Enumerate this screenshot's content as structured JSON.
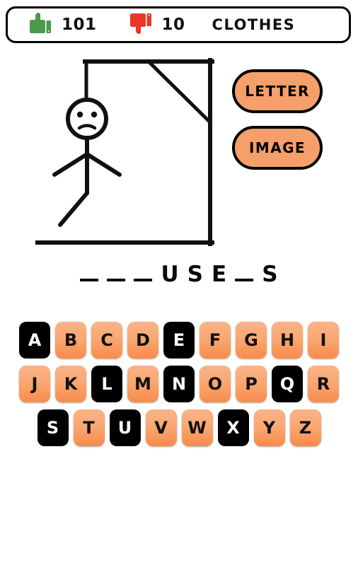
{
  "statusbar": {
    "thumbs_up_icon": "thumbs-up-icon",
    "thumbs_up_count": "101",
    "thumbs_down_icon": "thumbs-down-icon",
    "thumbs_down_count": "10",
    "category": "CLOTHES",
    "colors": {
      "thumbs_up": "#4a9a4a",
      "thumbs_down": "#e8372b",
      "border": "#000000",
      "background": "#ffffff"
    }
  },
  "gallows": {
    "description": "hangman-gallows-with-figure",
    "wrong_guesses_drawn": [
      "head",
      "body",
      "left-arm",
      "right-arm",
      "left-leg"
    ],
    "stroke_color": "#111111"
  },
  "actions": {
    "letter_label": "LETTER",
    "image_label": "IMAGE",
    "button_color": "#f5a06a"
  },
  "word": {
    "pattern": "_ _ _ U S E _ S",
    "slots": [
      "_",
      "_",
      "_",
      "U",
      "S",
      "E",
      "_",
      "S"
    ],
    "length": 8
  },
  "keyboard": {
    "rows": [
      [
        {
          "letter": "A",
          "used": true
        },
        {
          "letter": "B",
          "used": false
        },
        {
          "letter": "C",
          "used": false
        },
        {
          "letter": "D",
          "used": false
        },
        {
          "letter": "E",
          "used": true
        },
        {
          "letter": "F",
          "used": false
        },
        {
          "letter": "G",
          "used": false
        },
        {
          "letter": "H",
          "used": false
        },
        {
          "letter": "I",
          "used": false
        }
      ],
      [
        {
          "letter": "J",
          "used": false
        },
        {
          "letter": "K",
          "used": false
        },
        {
          "letter": "L",
          "used": true
        },
        {
          "letter": "M",
          "used": false
        },
        {
          "letter": "N",
          "used": true
        },
        {
          "letter": "O",
          "used": false
        },
        {
          "letter": "P",
          "used": false
        },
        {
          "letter": "Q",
          "used": true
        },
        {
          "letter": "R",
          "used": false
        }
      ],
      [
        {
          "letter": "S",
          "used": true
        },
        {
          "letter": "T",
          "used": false
        },
        {
          "letter": "U",
          "used": true
        },
        {
          "letter": "V",
          "used": false
        },
        {
          "letter": "W",
          "used": false
        },
        {
          "letter": "X",
          "used": true
        },
        {
          "letter": "Y",
          "used": false
        },
        {
          "letter": "Z",
          "used": false
        }
      ]
    ],
    "available_color": "#f9a873",
    "used_color": "#000000"
  }
}
